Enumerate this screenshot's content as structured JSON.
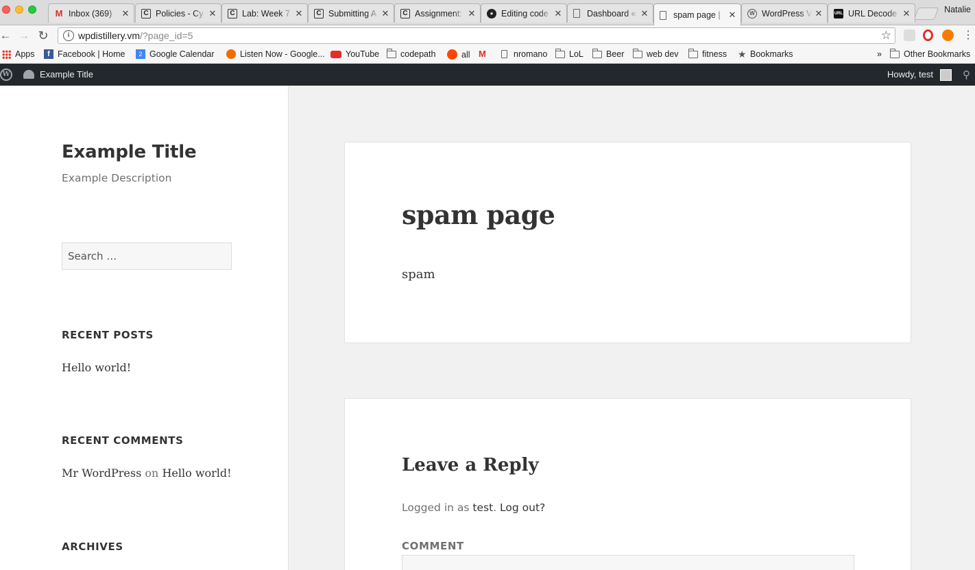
{
  "browser": {
    "profile_name": "Natalie",
    "tabs": [
      {
        "title": "Inbox (369)",
        "icon": "gmail-icon"
      },
      {
        "title": "Policies - Cy",
        "icon": "codepath-icon"
      },
      {
        "title": "Lab: Week 7",
        "icon": "codepath-icon"
      },
      {
        "title": "Submitting A",
        "icon": "codepath-icon"
      },
      {
        "title": "Assignment:",
        "icon": "codepath-icon"
      },
      {
        "title": "Editing code",
        "icon": "github-icon"
      },
      {
        "title": "Dashboard «",
        "icon": "page-icon"
      },
      {
        "title": "spam page |",
        "icon": "page-icon"
      },
      {
        "title": "WordPress V",
        "icon": "wordpress-icon"
      },
      {
        "title": "URL Decode",
        "icon": "url-icon"
      }
    ],
    "active_tab_index": 7,
    "url": {
      "host": "wpdistillery.vm",
      "path": "/?page_id=5"
    },
    "bookmarks": [
      {
        "label": "Apps",
        "icon": "apps-grid-icon"
      },
      {
        "label": "Facebook | Home",
        "icon": "facebook-icon"
      },
      {
        "label": "Google Calendar",
        "icon": "calendar-icon"
      },
      {
        "label": "Listen Now - Google...",
        "icon": "music-icon"
      },
      {
        "label": "YouTube",
        "icon": "youtube-icon"
      },
      {
        "label": "codepath",
        "icon": "folder-icon"
      },
      {
        "label": "all",
        "icon": "reddit-icon"
      },
      {
        "label": "",
        "icon": "gmail-icon"
      },
      {
        "label": "nromano",
        "icon": "page-icon"
      },
      {
        "label": "LoL",
        "icon": "folder-icon"
      },
      {
        "label": "Beer",
        "icon": "folder-icon"
      },
      {
        "label": "web dev",
        "icon": "folder-icon"
      },
      {
        "label": "fitness",
        "icon": "folder-icon"
      },
      {
        "label": "Bookmarks",
        "icon": "star-icon"
      }
    ],
    "more_bookmarks": "»",
    "other_bookmarks": "Other Bookmarks",
    "calendar_badge": "2",
    "url_favicon_text": "URL"
  },
  "adminbar": {
    "site_name": "Example Title",
    "howdy": "Howdy, test"
  },
  "sidebar": {
    "site_title": "Example Title",
    "site_description": "Example Description",
    "search_placeholder": "Search …",
    "recent_posts": {
      "title": "RECENT POSTS",
      "items": [
        "Hello world!"
      ]
    },
    "recent_comments": {
      "title": "RECENT COMMENTS",
      "author": "Mr WordPress",
      "on": "on",
      "post": "Hello world!"
    },
    "archives": {
      "title": "ARCHIVES"
    }
  },
  "article": {
    "title": "spam page",
    "content": "spam"
  },
  "comments": {
    "reply_title": "Leave a Reply",
    "logged_in_prefix": "Logged in as",
    "user": "test",
    "logout": "Log out?",
    "comment_label": "COMMENT"
  },
  "colors": {
    "admin_bar": "#23282d",
    "page_background": "#f1f1f1",
    "text": "#333333",
    "muted_text": "#707070"
  }
}
